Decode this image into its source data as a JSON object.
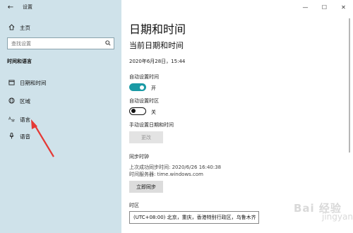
{
  "window": {
    "app_title": "设置",
    "controls": [
      "—",
      "☐",
      "✕"
    ]
  },
  "sidebar": {
    "home_label": "主页",
    "search_placeholder": "查找设置",
    "section_title": "时间和语言",
    "items": [
      {
        "label": "日期和时间",
        "icon": "calendar-icon"
      },
      {
        "label": "区域",
        "icon": "globe-icon"
      },
      {
        "label": "语言",
        "icon": "language-icon"
      },
      {
        "label": "语音",
        "icon": "microphone-icon"
      }
    ]
  },
  "main": {
    "title": "日期和时间",
    "current_heading": "当前日期和时间",
    "current_value": "2020年6月28日，15:44",
    "auto_time": {
      "label": "自动设置时间",
      "state": "开",
      "on": true
    },
    "auto_timezone": {
      "label": "自动设置时区",
      "state": "关",
      "on": false
    },
    "manual": {
      "label": "手动设置日期和时间",
      "button": "更改"
    },
    "sync": {
      "heading": "同步时钟",
      "last_sync": "上次成功同步时间: 2020/6/26 16:40:38",
      "server": "时间服务器: time.windows.com",
      "button": "立即同步"
    },
    "timezone": {
      "label": "时区",
      "value": "(UTC+08:00) 北京，重庆，香港特别行政区，乌鲁木齐"
    }
  },
  "annotation": {
    "color": "#e53935"
  },
  "colors": {
    "sidebar_bg": "#cfe2ea",
    "accent": "#1a9aa5"
  }
}
